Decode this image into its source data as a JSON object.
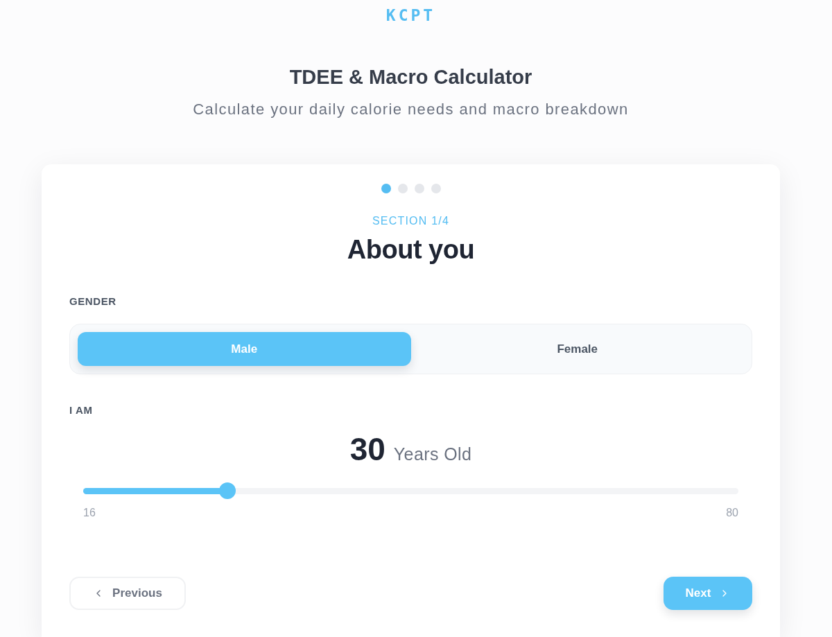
{
  "logo": {
    "text": "KCPT"
  },
  "header": {
    "title": "TDEE & Macro Calculator",
    "subtitle": "Calculate your daily calorie needs and macro breakdown"
  },
  "steps": [
    {
      "selected": true
    },
    {
      "selected": false
    },
    {
      "selected": false
    },
    {
      "selected": false
    }
  ],
  "section": {
    "eyebrow": "SECTION 1/4",
    "title": "About you"
  },
  "gender": {
    "label": "GENDER",
    "options": [
      {
        "label": "Male",
        "selected": true
      },
      {
        "label": "Female",
        "selected": false
      }
    ]
  },
  "age": {
    "label": "I AM",
    "value": "30",
    "unit": "Years Old",
    "level": 0.22,
    "min": "16",
    "max": "80"
  },
  "nav": {
    "previous": "Previous",
    "next": "Next"
  }
}
